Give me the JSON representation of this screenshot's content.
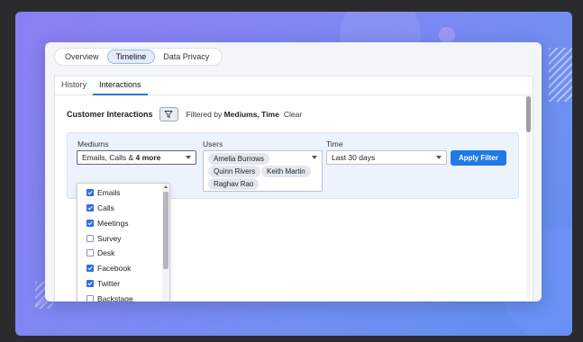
{
  "colors": {
    "accent": "#1f79e6",
    "check": "#2f6fde",
    "background": "#7f86f2"
  },
  "top_tabs": [
    {
      "label": "Overview",
      "active": false
    },
    {
      "label": "Timeline",
      "active": true
    },
    {
      "label": "Data Privacy",
      "active": false
    }
  ],
  "sub_tabs": [
    {
      "label": "History",
      "active": false
    },
    {
      "label": "Interactions",
      "active": true
    }
  ],
  "header": {
    "title": "Customer Interactions",
    "filter_icon": "funnel-icon",
    "filtered_prefix": "Filtered by",
    "filtered_fields": "Mediums, Time",
    "clear_label": "Clear"
  },
  "filters": {
    "mediums_label": "Mediums",
    "mediums_value": "Emails, Calls &",
    "mediums_more": "4 more",
    "users_label": "Users",
    "users": [
      "Amelia Burrows",
      "Quinn Rivers",
      "Keith Martin",
      "Raghav Rao"
    ],
    "time_label": "Time",
    "time_value": "Last 30 days",
    "apply_label": "Apply Filter"
  },
  "medium_options": [
    {
      "label": "Emails",
      "checked": true
    },
    {
      "label": "Calls",
      "checked": true
    },
    {
      "label": "Meetings",
      "checked": true
    },
    {
      "label": "Survey",
      "checked": false
    },
    {
      "label": "Desk",
      "checked": false
    },
    {
      "label": "Facebook",
      "checked": true
    },
    {
      "label": "Twitter",
      "checked": true
    },
    {
      "label": "Backstage",
      "checked": false
    }
  ]
}
